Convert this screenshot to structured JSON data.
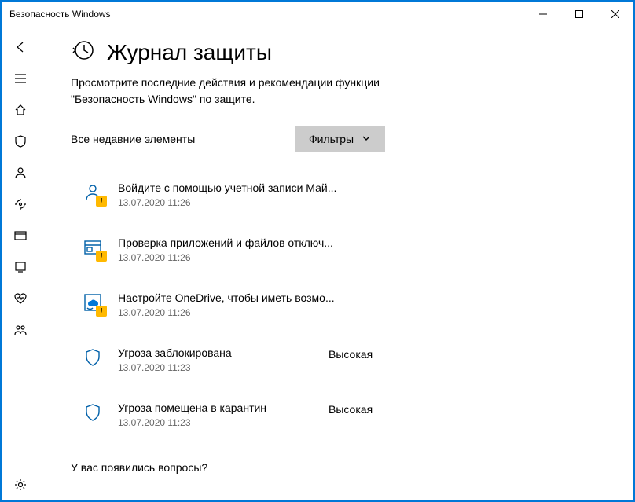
{
  "window": {
    "title": "Безопасность Windows"
  },
  "page": {
    "title": "Журнал защиты",
    "description": "Просмотрите последние действия и рекомендации функции \"Безопасность Windows\" по защите."
  },
  "filter": {
    "section_label": "Все недавние элементы",
    "button_label": "Фильтры"
  },
  "events": [
    {
      "icon": "person",
      "warn": true,
      "title": "Войдите с помощью учетной записи Май...",
      "time": "13.07.2020 11:26",
      "severity": ""
    },
    {
      "icon": "window",
      "warn": true,
      "title": "Проверка приложений и файлов отключ...",
      "time": "13.07.2020 11:26",
      "severity": ""
    },
    {
      "icon": "onedrive",
      "warn": true,
      "title": "Настройте OneDrive, чтобы иметь возмо...",
      "time": "13.07.2020 11:26",
      "severity": ""
    },
    {
      "icon": "shield",
      "warn": false,
      "title": "Угроза заблокирована",
      "time": "13.07.2020 11:23",
      "severity": "Высокая"
    },
    {
      "icon": "shield",
      "warn": false,
      "title": "Угроза помещена в карантин",
      "time": "13.07.2020 11:23",
      "severity": "Высокая"
    }
  ],
  "footer": {
    "question": "У вас появились вопросы?"
  }
}
